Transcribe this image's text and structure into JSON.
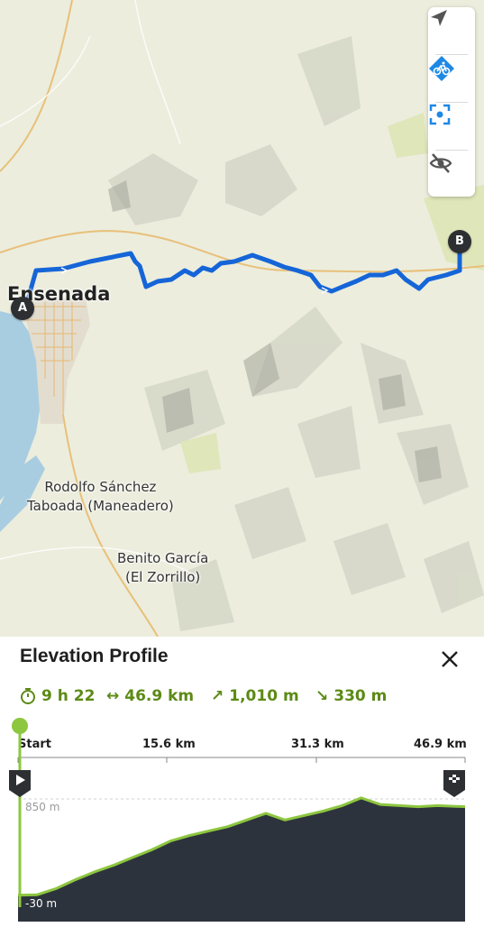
{
  "map": {
    "places": {
      "city": "Ensenada",
      "town1_line1": "Rodolfo Sánchez",
      "town1_line2": "Taboada (Maneadero)",
      "town2_line1": "Benito García",
      "town2_line2": "(El Zorrillo)"
    },
    "start_marker": "A",
    "end_marker": "B",
    "route_color": "#1565d8"
  },
  "toolbar": {
    "buttons": [
      {
        "icon": "navigation-arrow-icon"
      },
      {
        "icon": "bike-route-icon",
        "color": "#1e88e5"
      },
      {
        "icon": "recenter-icon",
        "color": "#1e88e5"
      },
      {
        "icon": "hide-eye-icon"
      }
    ]
  },
  "panel": {
    "title": "Elevation Profile",
    "stats": {
      "duration": "9 h 22",
      "distance": "46.9 km",
      "ascent": "1,010 m",
      "descent": "330 m"
    },
    "accent_color": "#5c8a16",
    "axis": {
      "labels": [
        "Start",
        "15.6 km",
        "31.3 km",
        "46.9 km"
      ]
    },
    "elevation_labels": {
      "max": "850 m",
      "min": "-30 m"
    }
  },
  "chart_data": {
    "type": "area",
    "x": [
      0,
      2,
      4,
      6,
      8,
      10,
      12,
      14,
      16,
      18,
      20,
      22,
      24,
      26,
      28,
      30,
      32,
      34,
      36,
      38,
      40,
      42,
      44,
      46.9
    ],
    "y": [
      -20,
      -15,
      40,
      120,
      190,
      250,
      320,
      390,
      470,
      520,
      560,
      600,
      660,
      720,
      660,
      700,
      740,
      790,
      860,
      800,
      790,
      780,
      790,
      780
    ],
    "ylim": [
      -30,
      850
    ],
    "xlim": [
      0,
      46.9
    ],
    "xticks": [
      "Start",
      "15.6 km",
      "31.3 km",
      "46.9 km"
    ],
    "fill_color": "#2d333d",
    "line_color": "#8dc63f"
  }
}
